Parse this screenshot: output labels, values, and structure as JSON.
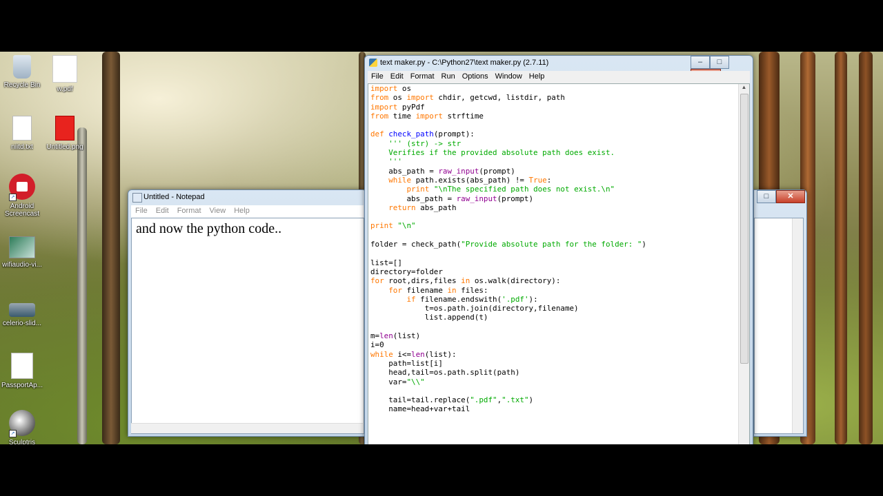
{
  "desktop": {
    "icons": [
      {
        "label": "Recycle Bin"
      },
      {
        "label": "w.pdf"
      },
      {
        "label": "niitd.txt"
      },
      {
        "label": "Untitled.png"
      },
      {
        "label": "Android Screencast"
      },
      {
        "label": "wifiaudio-vi..."
      },
      {
        "label": "celerio-slid..."
      },
      {
        "label": "PassportAp..."
      },
      {
        "label": "Sculptris"
      }
    ]
  },
  "notepad": {
    "title": "Untitled - Notepad",
    "menu": [
      "File",
      "Edit",
      "Format",
      "View",
      "Help"
    ],
    "content": "and now the python code..",
    "buttons": {
      "minimize": "–",
      "maximize": "□",
      "close": "✕"
    }
  },
  "right_window": {
    "buttons": {
      "maximize": "□",
      "close": "✕"
    }
  },
  "idle": {
    "title": "text maker.py - C:\\Python27\\text maker.py (2.7.11)",
    "menu": [
      "File",
      "Edit",
      "Format",
      "Run",
      "Options",
      "Window",
      "Help"
    ],
    "buttons": {
      "minimize": "–",
      "maximize": "□",
      "close": "✕"
    },
    "code_lines": [
      "import os",
      "from os import chdir, getcwd, listdir, path",
      "import pyPdf",
      "from time import strftime",
      "",
      "def check_path(prompt):",
      "    ''' (str) -> str",
      "    Verifies if the provided absolute path does exist.",
      "    '''",
      "    abs_path = raw_input(prompt)",
      "    while path.exists(abs_path) != True:",
      "        print \"\\nThe specified path does not exist.\\n\"",
      "        abs_path = raw_input(prompt)",
      "    return abs_path",
      "",
      "print \"\\n\"",
      "",
      "folder = check_path(\"Provide absolute path for the folder: \")",
      "",
      "list=[]",
      "directory=folder",
      "for root,dirs,files in os.walk(directory):",
      "    for filename in files:",
      "        if filename.endswith('.pdf'):",
      "            t=os.path.join(directory,filename)",
      "            list.append(t)",
      "",
      "m=len(list)",
      "i=0",
      "while i<=len(list):",
      "    path=list[i]",
      "    head,tail=os.path.split(path)",
      "    var=\"\\\\\"",
      "",
      "    tail=tail.replace(\".pdf\",\".txt\")",
      "    name=head+var+tail"
    ]
  },
  "colors": {
    "keyword": "#ff7700",
    "builtin": "#900090",
    "string": "#00aa00",
    "definition": "#0000ff"
  }
}
